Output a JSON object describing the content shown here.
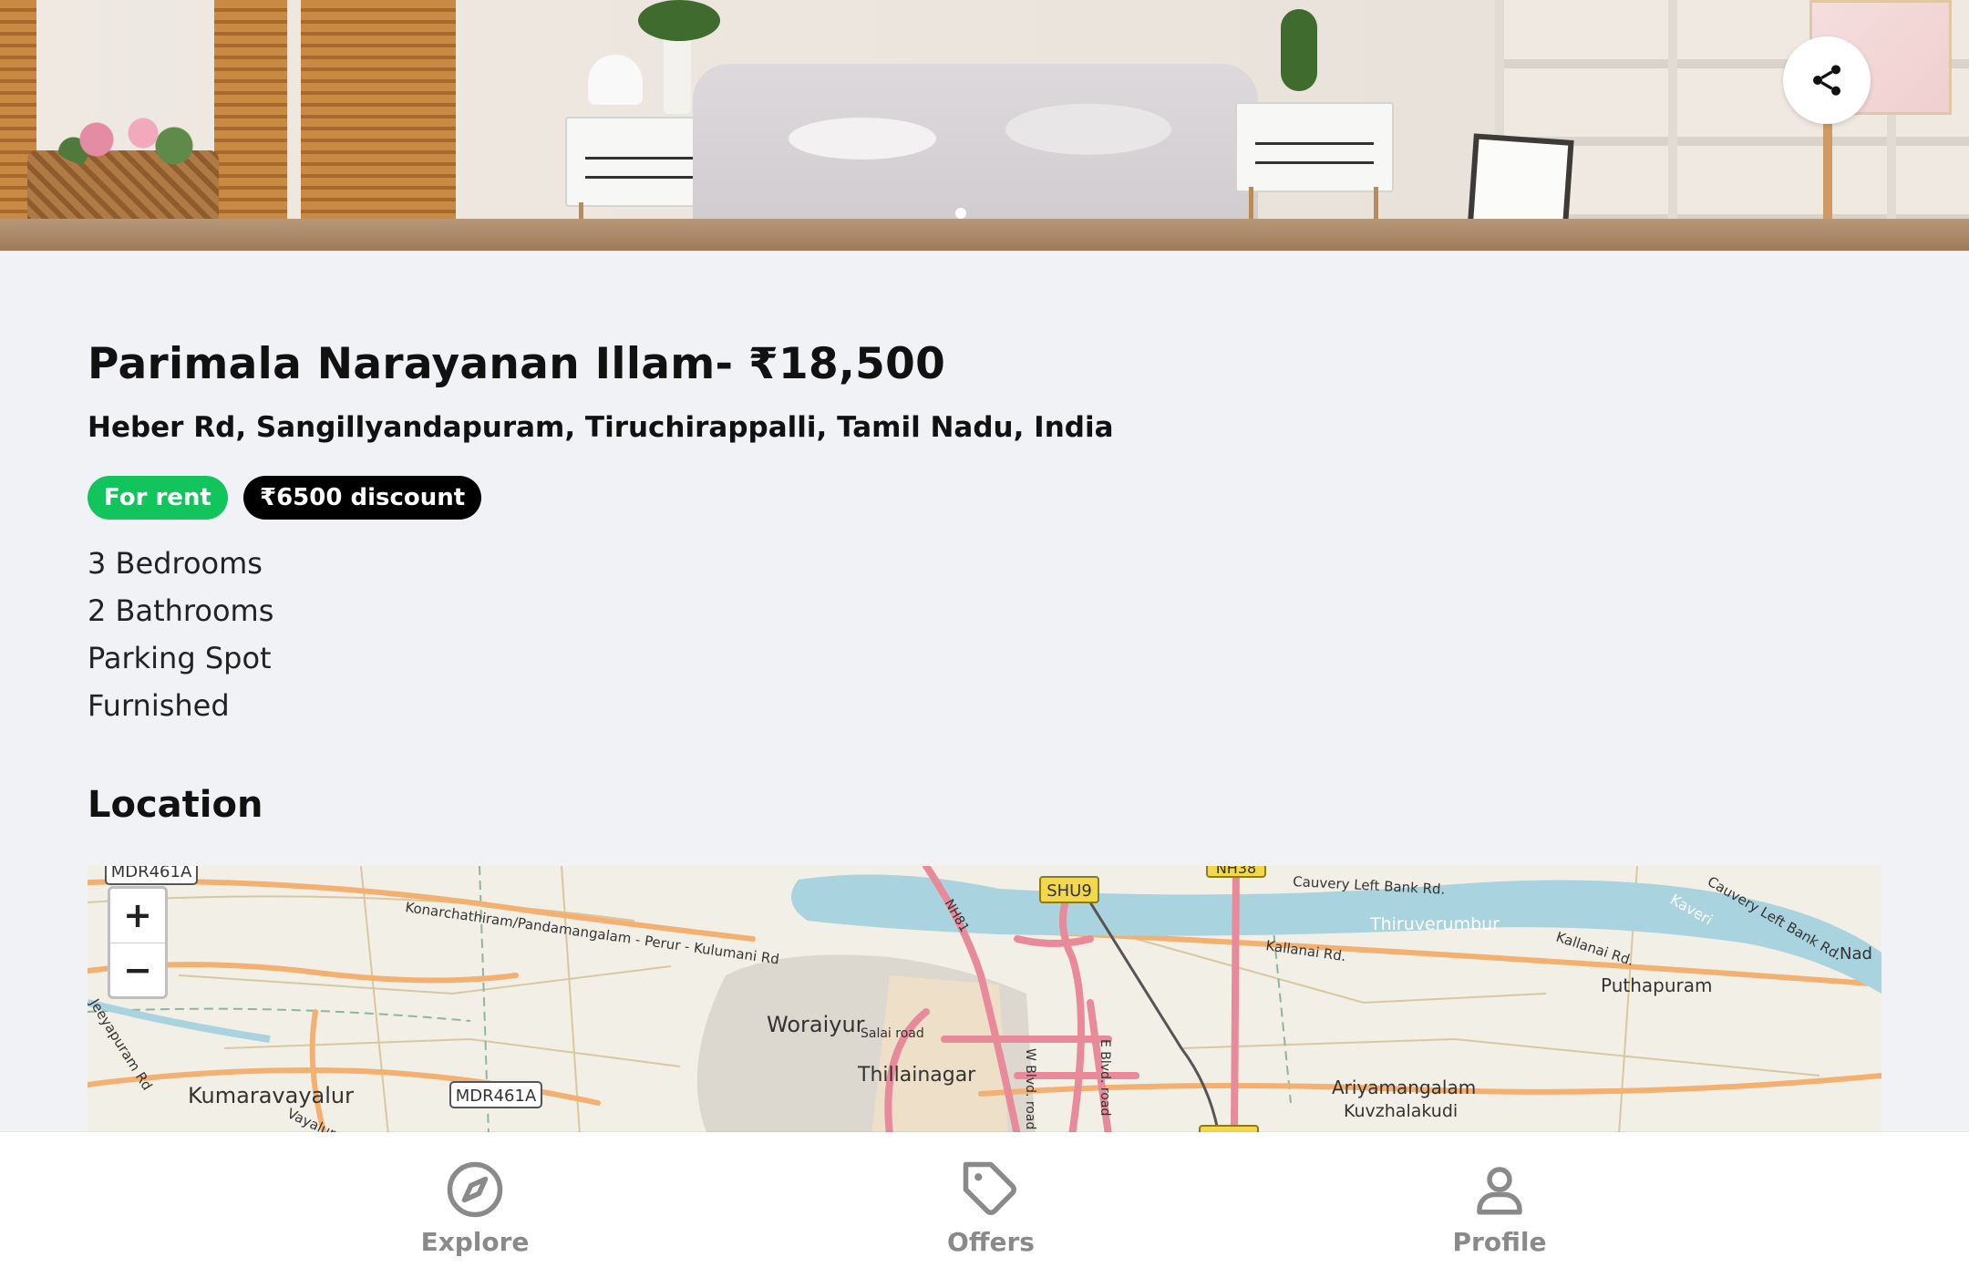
{
  "listing": {
    "title": "Parimala Narayanan Illam- ₹18,500",
    "address": "Heber Rd, Sangillyandapuram, Tiruchirappalli, Tamil Nadu, India",
    "badges": {
      "status": "For rent",
      "discount": "₹6500 discount"
    },
    "features": [
      "3 Bedrooms",
      "2 Bathrooms",
      "Parking Spot",
      "Furnished"
    ]
  },
  "hero": {
    "share_icon": "share-icon",
    "slide_indicator": "1"
  },
  "location": {
    "heading": "Location",
    "zoom_in": "+",
    "zoom_out": "−",
    "map_labels": {
      "mdr_top": "MDR461A",
      "mdr_mid": "MDR461A",
      "shu9": "SHU9",
      "nh_top": "NH38",
      "road_konar": "Konarchathiram/Pandamangalam - Perur - Kulumani Rd",
      "cauvery_left_top": "Cauvery Left Bank Rd.",
      "cauvery_left_right": "Cauvery Left Bank Rd.",
      "thiruverumbur": "Thiruverumbur",
      "kaveri": "Kaveri",
      "kallanai_1": "Kallanai Rd.",
      "kallanai_2": "Kallanai Rd.",
      "nad": "Nad",
      "puthapuram": "Puthapuram",
      "woraiyur": "Woraiyur",
      "salai_road": "Salai road",
      "thillainagar": "Thillainagar",
      "w_blvd": "W Blvd. road",
      "e_blvd": "E Blvd. road",
      "nh81": "NH81",
      "kumaravayalur": "Kumaravayalur",
      "vayalur": "Vayalur",
      "jeeyapuram": "Jeeyapuram Rd",
      "ariyamangalam": "Ariyamangalam",
      "kuvzhalakudi": "Kuvzhalakudi"
    }
  },
  "nav": {
    "explore": "Explore",
    "offers": "Offers",
    "profile": "Profile"
  },
  "colors": {
    "rent_green": "#11c45b",
    "discount_black": "#000000",
    "river": "#a9d3df",
    "major_road": "#e88a9a"
  }
}
